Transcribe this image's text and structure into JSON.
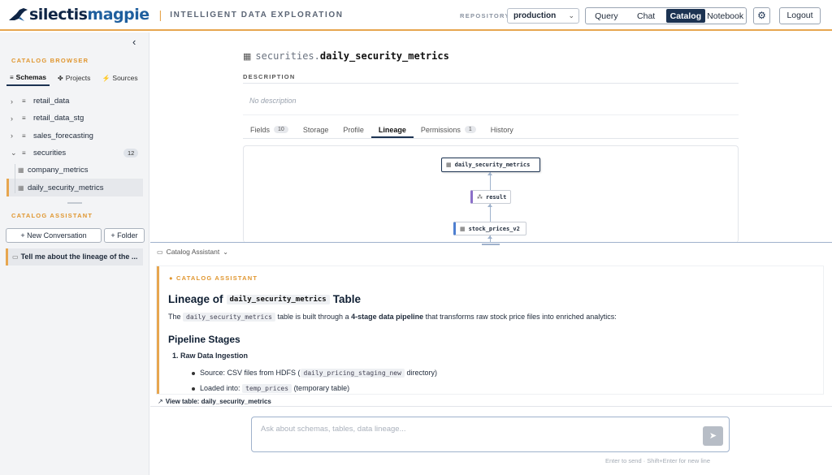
{
  "header": {
    "logo_primary": "silectis",
    "logo_secondary": "magpie",
    "separator": "|",
    "tagline": "INTELLIGENT DATA EXPLORATION",
    "repository_label": "REPOSITORY",
    "repository_value": "production",
    "modes": [
      "Query",
      "Chat",
      "Catalog",
      "Notebook"
    ],
    "active_mode": "Catalog",
    "settings_icon": "gear-icon",
    "logout_label": "Logout",
    "accent_color": "#e7a64f",
    "brand_color": "#1c3352"
  },
  "sidebar": {
    "catalog_browser_title": "CATALOG BROWSER",
    "tabs": [
      {
        "label": "Schemas",
        "icon": "database-icon"
      },
      {
        "label": "Projects",
        "icon": "project-icon"
      },
      {
        "label": "Sources",
        "icon": "plug-icon"
      }
    ],
    "schemas": [
      {
        "name": "retail_data"
      },
      {
        "name": "retail_data_stg"
      },
      {
        "name": "sales_forecasting"
      },
      {
        "name": "securities",
        "count": "12"
      }
    ],
    "tables": [
      {
        "name": "company_metrics"
      },
      {
        "name": "daily_security_metrics"
      }
    ],
    "assistant_title": "CATALOG ASSISTANT",
    "new_conversation_label": "+ New Conversation",
    "folder_label": "+ Folder",
    "conversation": "Tell me about the lineage of the ..."
  },
  "table": {
    "schema": "securities.",
    "name": "daily_security_metrics",
    "description_label": "DESCRIPTION",
    "description": "No description",
    "tabs": [
      {
        "label": "Fields",
        "count": "10"
      },
      {
        "label": "Storage"
      },
      {
        "label": "Profile"
      },
      {
        "label": "Lineage"
      },
      {
        "label": "Permissions",
        "count": "1"
      },
      {
        "label": "History"
      }
    ],
    "active_tab": "Lineage",
    "lineage_nodes": {
      "top": "daily_security_metrics",
      "middle": "result",
      "bottom": "stock_prices_v2"
    }
  },
  "assistant": {
    "panel_title": "Catalog Assistant",
    "message_label": "CATALOG ASSISTANT",
    "heading_prefix": "Lineage of",
    "heading_code": "daily_security_metrics",
    "heading_suffix": "Table",
    "intro_the": "The",
    "intro_code": "daily_security_metrics",
    "intro_mid": "table is built through a",
    "intro_bold": "4-stage data pipeline",
    "intro_end": "that transforms raw stock price files into enriched analytics:",
    "pipeline_heading": "Pipeline Stages",
    "stage1": "1. Raw Data Ingestion",
    "source_prefix": "Source: CSV files from HDFS (",
    "source_code": "daily_pricing_staging_new",
    "source_suffix": "directory)",
    "loaded_prefix": "Loaded into:",
    "loaded_code": "temp_prices",
    "loaded_suffix": "(temporary table)",
    "view_table": "View table: daily_security_metrics",
    "input_placeholder": "Ask about schemas, tables, data lineage...",
    "hint": "Enter to send · Shift+Enter for new line"
  }
}
